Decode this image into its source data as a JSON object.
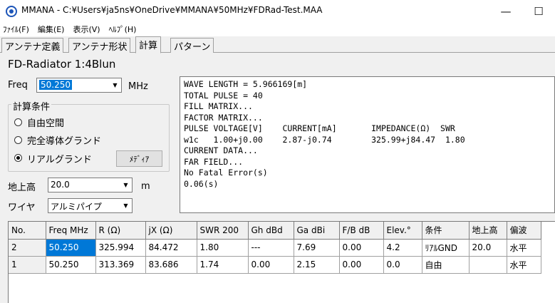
{
  "window": {
    "title": "MMANA - C:¥Users¥ja5ns¥OneDrive¥MMANA¥50MHz¥FDRad-Test.MAA",
    "minimize": "—",
    "maximize": "☐",
    "close": "✕"
  },
  "menu": [
    "ﾌｧｲﾙ(F)",
    "編集(E)",
    "表示(V)",
    "ﾍﾙﾌﾟ(H)"
  ],
  "tabs": [
    "アンテナ定義",
    "アンテナ形状",
    "計算",
    "パターン"
  ],
  "active_tab": "計算",
  "project_name": "FD-Radiator 1:4Blun",
  "freq": {
    "label": "Freq",
    "value": "50.250",
    "unit": "MHz"
  },
  "conditions": {
    "title": "計算条件",
    "options": [
      "自由空間",
      "完全導体グランド",
      "リアルグランド"
    ],
    "selected": "リアルグランド",
    "media_button": "ﾒﾃﾞｨｱ"
  },
  "height": {
    "label": "地上高",
    "value": "20.0",
    "unit": "m"
  },
  "wire": {
    "label": "ワイヤ",
    "value": "アルミパイプ"
  },
  "output_lines": [
    "WAVE LENGTH = 5.966169[m]",
    "TOTAL PULSE = 40",
    "FILL MATRIX...",
    "FACTOR MATRIX...",
    "PULSE VOLTAGE[V]    CURRENT[mA]       IMPEDANCE(Ω)  SWR",
    "w1c   1.00+j0.00    2.87-j0.74        325.99+j84.47  1.80",
    "CURRENT DATA...",
    "FAR FIELD...",
    "No Fatal Error(s)",
    "0.06(s)"
  ],
  "table": {
    "headers": [
      "No.",
      "Freq MHz",
      "R (Ω)",
      "jX (Ω)",
      "SWR 200",
      "Gh dBd",
      "Ga dBi",
      "F/B dB",
      "Elev.°",
      "条件",
      "地上高",
      "偏波"
    ],
    "rows": [
      [
        "2",
        "50.250",
        "325.994",
        "84.472",
        "1.80",
        "---",
        "7.69",
        "0.00",
        "4.2",
        "ﾘｱﾙGND",
        "20.0",
        "水平"
      ],
      [
        "1",
        "50.250",
        "313.369",
        "83.686",
        "1.74",
        "0.00",
        "2.15",
        "0.00",
        "0.0",
        "自由",
        "",
        "水平"
      ]
    ]
  }
}
